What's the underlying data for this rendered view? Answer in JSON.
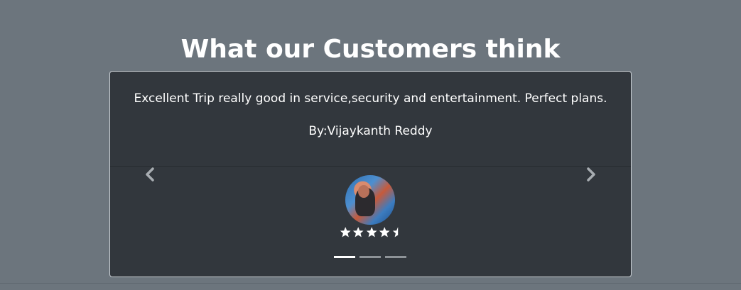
{
  "section": {
    "heading": "What our Customers think"
  },
  "testimonial": {
    "quote": "Excellent Trip really good in service,security and entertainment. Perfect plans.",
    "author": "By:Vijaykanth Reddy",
    "rating": 4.5,
    "rating_max": 5
  },
  "carousel": {
    "prev_icon": "chevron-left-icon",
    "next_icon": "chevron-right-icon",
    "slide_count": 3,
    "active_index": 0
  },
  "colors": {
    "page_bg": "#6c757d",
    "card_bg": "#32373d",
    "text": "#ffffff"
  }
}
